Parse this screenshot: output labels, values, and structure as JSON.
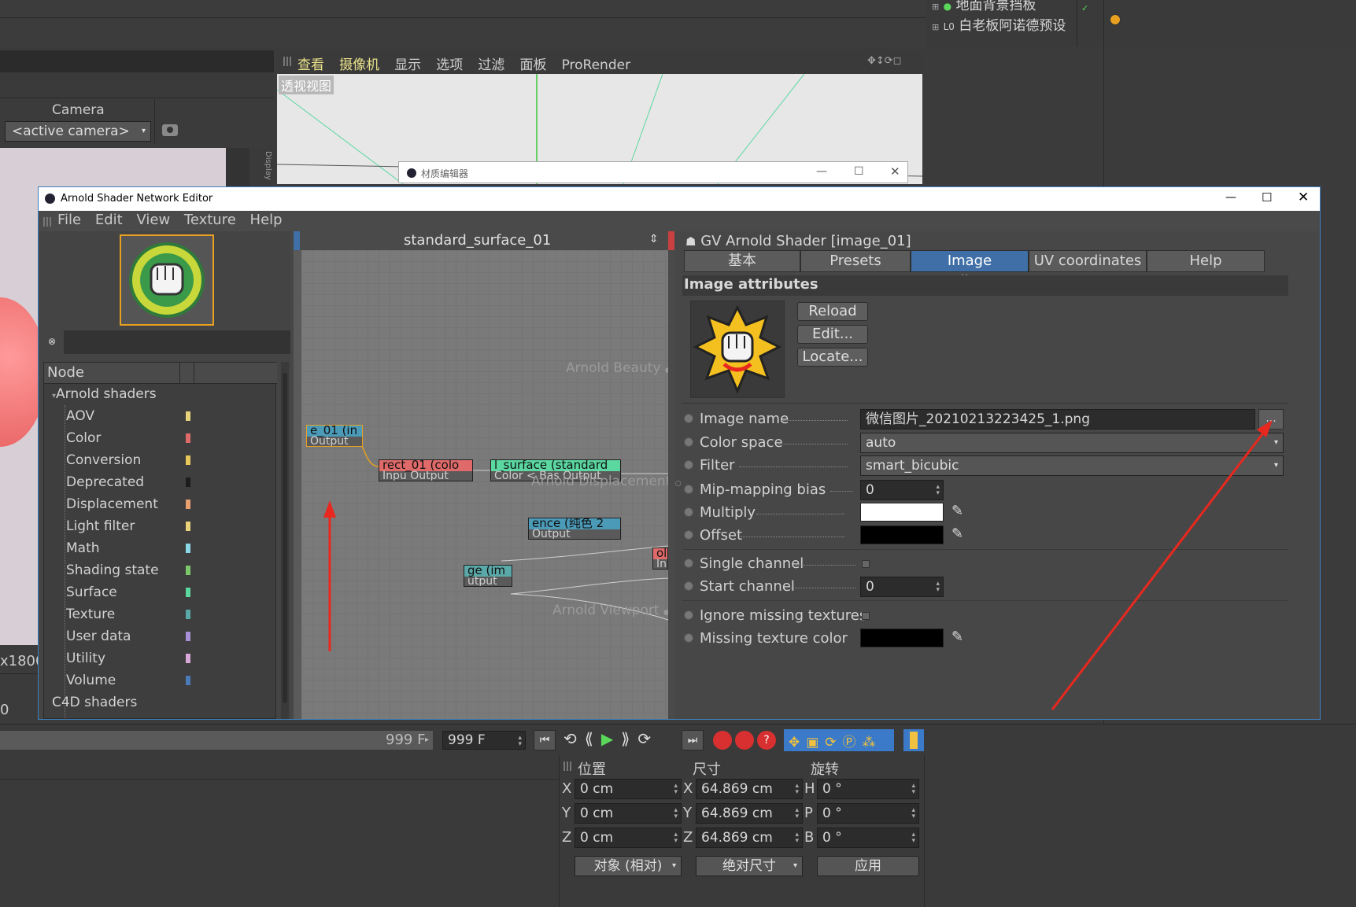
{
  "object_manager": {
    "items": [
      {
        "label": "地面背景挡板"
      },
      {
        "label": "白老板阿诺德预设"
      }
    ]
  },
  "viewport": {
    "menu": [
      "查看",
      "摄像机",
      "显示",
      "选项",
      "过滤",
      "面板",
      "ProRender"
    ],
    "view_label": "透视视图",
    "side_tab": "Display"
  },
  "camera_panel": {
    "title": "Camera",
    "selected": "<active camera>"
  },
  "material_editor": {
    "title": "材质编辑器"
  },
  "left_readouts": {
    "size": "x1800",
    "zero": "0"
  },
  "arnold_window": {
    "title": "Arnold Shader Network Editor",
    "menu": [
      "File",
      "Edit",
      "View",
      "Texture",
      "Help"
    ],
    "tree_header": "Node",
    "tree_root": "Arnold shaders",
    "tree_items": [
      {
        "label": "AOV",
        "color": "#e8d27a"
      },
      {
        "label": "Color",
        "color": "#e06a6a"
      },
      {
        "label": "Conversion",
        "color": "#e8c85a"
      },
      {
        "label": "Deprecated",
        "color": "#1c1c1c"
      },
      {
        "label": "Displacement",
        "color": "#e8a070"
      },
      {
        "label": "Light filter",
        "color": "#e8d27a"
      },
      {
        "label": "Math",
        "color": "#8ad8e8"
      },
      {
        "label": "Shading state",
        "color": "#7ac86a"
      },
      {
        "label": "Surface",
        "color": "#5ad8a0"
      },
      {
        "label": "Texture",
        "color": "#5aa8a8"
      },
      {
        "label": "User data",
        "color": "#a890d8"
      },
      {
        "label": "Utility",
        "color": "#d8a8d8"
      },
      {
        "label": "Volume",
        "color": "#4a7ab8"
      }
    ],
    "tree_last": "C4D shaders",
    "network_title": "standard_surface_01",
    "ports": {
      "beauty": "Arnold Beauty",
      "displacement": "Arnold Displacement",
      "viewport": "Arnold Viewport"
    },
    "nodes": [
      {
        "top": "e_01 (in",
        "bottom": "Output"
      },
      {
        "top": "rect_01 (colo",
        "bottom": "Inpu Output"
      },
      {
        "top": "l_surface (standard",
        "bottom": "Color < Bas Output"
      },
      {
        "top": "ence (纯色 2",
        "bottom": "Output"
      },
      {
        "top": "ge (im",
        "bottom": "utput"
      },
      {
        "top": "ol",
        "bottom": "In"
      }
    ],
    "attr_title": "GV Arnold Shader [image_01]",
    "tabs": [
      "基本",
      "Presets",
      "Image attributes",
      "UV coordinates",
      "Help"
    ],
    "section": "Image attributes",
    "buttons": [
      "Reload",
      "Edit...",
      "Locate..."
    ],
    "attributes": {
      "image_name": {
        "label": "Image name",
        "value": "微信图片_20210213223425_1.png",
        "browse": "..."
      },
      "color_space": {
        "label": "Color space",
        "value": "auto"
      },
      "filter": {
        "label": "Filter",
        "value": "smart_bicubic"
      },
      "mip_bias": {
        "label": "Mip-mapping bias",
        "value": "0"
      },
      "multiply": {
        "label": "Multiply",
        "color": "#ffffff"
      },
      "offset": {
        "label": "Offset",
        "color": "#000000"
      },
      "single_channel": {
        "label": "Single channel"
      },
      "start_channel": {
        "label": "Start channel",
        "value": "0"
      },
      "ignore_missing": {
        "label": "Ignore missing textures"
      },
      "missing_color": {
        "label": "Missing texture color",
        "color": "#000000"
      }
    }
  },
  "timeline": {
    "end_frame_a": "999 F",
    "end_frame_b": "999 F"
  },
  "coords": {
    "headers": [
      "位置",
      "尺寸",
      "旋转"
    ],
    "rows": [
      {
        "axis": "X",
        "pos": "0 cm",
        "saxis": "X",
        "size": "64.869 cm",
        "raxis": "H",
        "rot": "0 °"
      },
      {
        "axis": "Y",
        "pos": "0 cm",
        "saxis": "Y",
        "size": "64.869 cm",
        "raxis": "P",
        "rot": "0 °"
      },
      {
        "axis": "Z",
        "pos": "0 cm",
        "saxis": "Z",
        "size": "64.869 cm",
        "raxis": "B",
        "rot": "0 °"
      }
    ],
    "mode": "对象 (相对)",
    "size_mode": "绝对尺寸",
    "apply": "应用"
  },
  "colors": {
    "accent": "#3f6fa6",
    "annotation": "#e8281e"
  }
}
